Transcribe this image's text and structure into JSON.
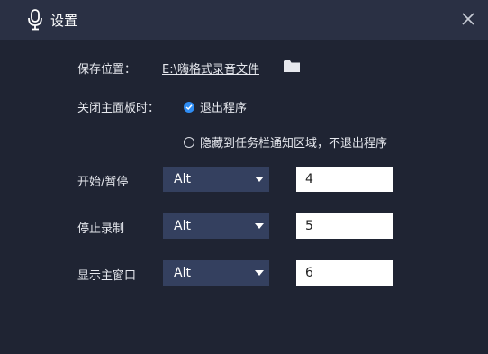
{
  "window": {
    "title": "设置",
    "close_icon": "close-icon",
    "mic_icon": "microphone-icon"
  },
  "save_location": {
    "label": "保存位置：",
    "path": "E:\\嗨格式录音文件",
    "folder_icon": "folder-icon"
  },
  "close_panel": {
    "label": "关闭主面板时：",
    "options": [
      {
        "label": "退出程序",
        "checked": true
      },
      {
        "label": "隐藏到任务栏通知区域，不退出程序",
        "checked": false
      }
    ]
  },
  "hotkeys": [
    {
      "label": "开始/暂停",
      "modifier": "Alt",
      "key": "4"
    },
    {
      "label": "停止录制",
      "modifier": "Alt",
      "key": "5"
    },
    {
      "label": "显示主窗口",
      "modifier": "Alt",
      "key": "6"
    }
  ],
  "colors": {
    "background": "#1f2433",
    "titlebar": "#2a3044",
    "select_bg": "#34405f",
    "accent": "#2f8df4"
  }
}
